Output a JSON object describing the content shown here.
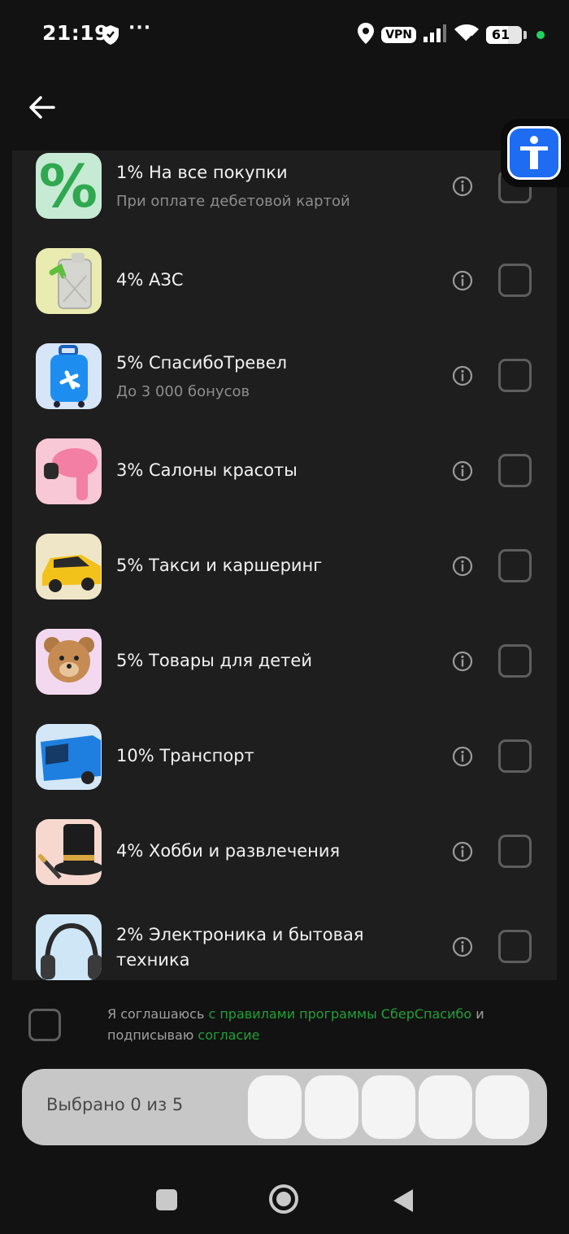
{
  "status": {
    "time": "21:19",
    "dots": "···",
    "vpn": "VPN",
    "battery": "61"
  },
  "items": [
    {
      "title": "1% На все покупки",
      "subtitle": "При оплате дебетовой картой",
      "icon": "percent-icon",
      "bg": "#c6ead3"
    },
    {
      "title": "4% АЗС",
      "subtitle": "",
      "icon": "jerrycan-icon",
      "bg": "#e9ebb0"
    },
    {
      "title": "5% СпасибоТревел",
      "subtitle": "До 3 000 бонусов",
      "icon": "suitcase-icon",
      "bg": "#d6e6f8"
    },
    {
      "title": "3% Салоны красоты",
      "subtitle": "",
      "icon": "hairdryer-icon",
      "bg": "#f9c8d6"
    },
    {
      "title": "5% Такси и каршеринг",
      "subtitle": "",
      "icon": "taxi-icon",
      "bg": "#efe6c8"
    },
    {
      "title": "5% Товары для детей",
      "subtitle": "",
      "icon": "teddy-bear-icon",
      "bg": "#f3d9f0"
    },
    {
      "title": "10% Транспорт",
      "subtitle": "",
      "icon": "bus-icon",
      "bg": "#d3e7f7"
    },
    {
      "title": "4% Хобби и развлечения",
      "subtitle": "",
      "icon": "top-hat-icon",
      "bg": "#f7d8cf"
    },
    {
      "title": "2% Электроника и бытовая техника",
      "subtitle": "",
      "icon": "headphones-icon",
      "bg": "#cfe6f6"
    }
  ],
  "agreement": {
    "part1": "Я соглашаюсь ",
    "link1": "с правилами программы СберСпасибо",
    "part2": " и подписываю ",
    "link2": "согласие"
  },
  "selection": {
    "label": "Выбрано 0 из 5",
    "selected": 0,
    "max": 5
  }
}
